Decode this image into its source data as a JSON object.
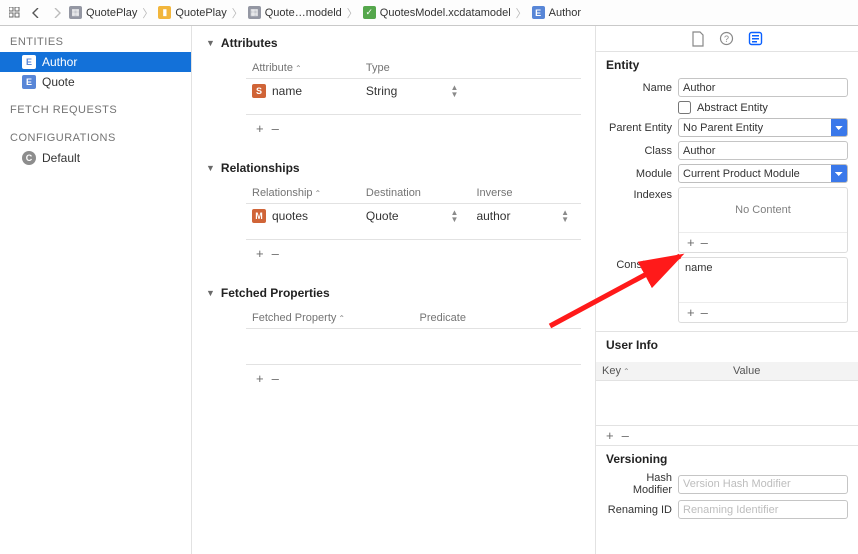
{
  "crumbs": {
    "items": [
      "QuotePlay",
      "QuotePlay",
      "Quote…modeld",
      "QuotesModel.xcdatamodel",
      "Author"
    ],
    "icons": [
      "doc-icon",
      "folder-icon",
      "doc-icon",
      "model-icon",
      "entity-icon"
    ]
  },
  "left": {
    "sections": {
      "entities": "ENTITIES",
      "fetch_requests": "FETCH REQUESTS",
      "configurations": "CONFIGURATIONS"
    },
    "entities": [
      "Author",
      "Quote"
    ],
    "configurations": [
      "Default"
    ]
  },
  "center": {
    "attributes": {
      "title": "Attributes",
      "cols": {
        "attribute": "Attribute",
        "type": "Type"
      },
      "rows": [
        {
          "name": "name",
          "type": "String"
        }
      ]
    },
    "relationships": {
      "title": "Relationships",
      "cols": {
        "relationship": "Relationship",
        "destination": "Destination",
        "inverse": "Inverse"
      },
      "rows": [
        {
          "name": "quotes",
          "destination": "Quote",
          "inverse": "author"
        }
      ]
    },
    "fetched": {
      "title": "Fetched Properties",
      "cols": {
        "fetched": "Fetched Property",
        "predicate": "Predicate"
      }
    },
    "plus": "+",
    "minus": "–"
  },
  "inspector": {
    "entity": {
      "title": "Entity",
      "name_label": "Name",
      "name_value": "Author",
      "abstract_label": "Abstract Entity",
      "parent_label": "Parent Entity",
      "parent_value": "No Parent Entity",
      "class_label": "Class",
      "class_value": "Author",
      "module_label": "Module",
      "module_value": "Current Product Module",
      "indexes_label": "Indexes",
      "indexes_placeholder": "No Content",
      "constraints_label": "Constraints",
      "constraints_value": "name"
    },
    "userinfo": {
      "title": "User Info",
      "key": "Key",
      "value": "Value"
    },
    "versioning": {
      "title": "Versioning",
      "hash_label": "Hash Modifier",
      "hash_placeholder": "Version Hash Modifier",
      "rename_label": "Renaming ID",
      "rename_placeholder": "Renaming Identifier"
    }
  }
}
